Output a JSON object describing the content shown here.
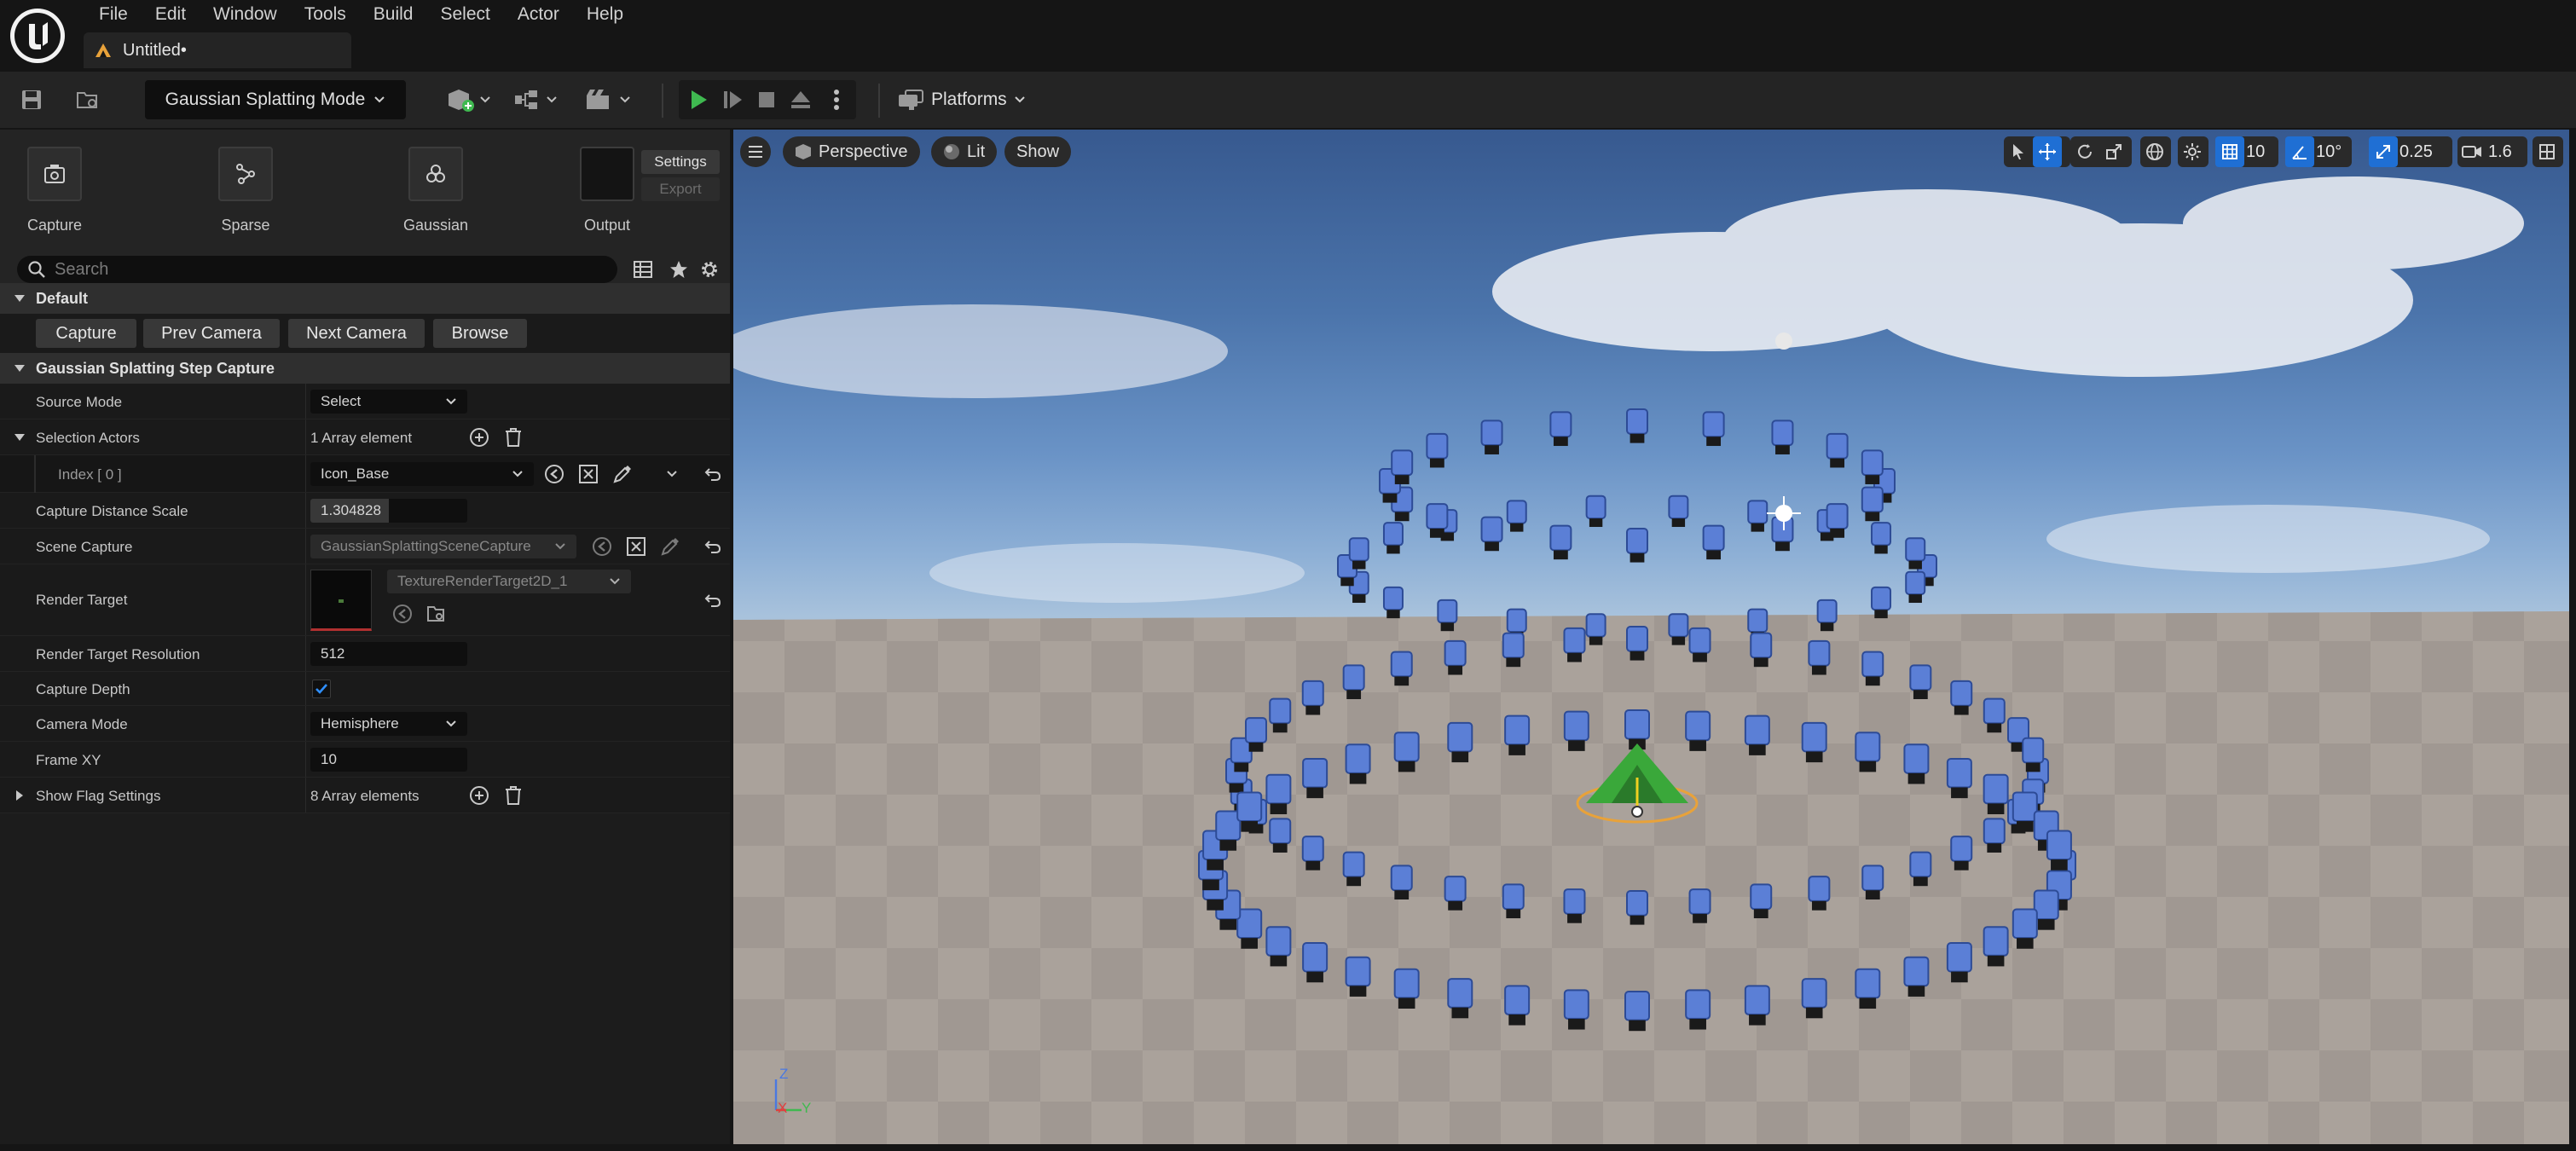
{
  "menu": [
    "File",
    "Edit",
    "Window",
    "Tools",
    "Build",
    "Select",
    "Actor",
    "Help"
  ],
  "document_tab": {
    "title": "Untitled•"
  },
  "toolbar": {
    "mode_select": "Gaussian Splatting Mode",
    "platforms_label": "Platforms"
  },
  "steps": [
    {
      "label": "Capture",
      "icon": "camera-icon"
    },
    {
      "label": "Sparse",
      "icon": "graph-icon"
    },
    {
      "label": "Gaussian",
      "icon": "circles-icon"
    },
    {
      "label": "Output",
      "icon": "output-preview"
    }
  ],
  "settings_label": "Settings",
  "export_label": "Export",
  "search": {
    "placeholder": "Search"
  },
  "default_category": {
    "title": "Default",
    "buttons": [
      "Capture",
      "Prev Camera",
      "Next Camera",
      "Browse"
    ]
  },
  "capture_category": {
    "title": "Gaussian Splatting Step Capture",
    "source_mode": {
      "label": "Source Mode",
      "value": "Select"
    },
    "selection_actors": {
      "label": "Selection Actors",
      "value": "1 Array element"
    },
    "index0": {
      "label": "Index [ 0 ]",
      "value": "Icon_Base"
    },
    "capture_distance_scale": {
      "label": "Capture Distance Scale",
      "value": "1.304828",
      "fill_fraction": 0.5
    },
    "scene_capture": {
      "label": "Scene Capture",
      "value": "GaussianSplattingSceneCapture"
    },
    "render_target": {
      "label": "Render Target",
      "value": "TextureRenderTarget2D_1"
    },
    "render_target_resolution": {
      "label": "Render Target Resolution",
      "value": "512"
    },
    "capture_depth": {
      "label": "Capture Depth",
      "checked": true
    },
    "camera_mode": {
      "label": "Camera Mode",
      "value": "Hemisphere"
    },
    "frame_xy": {
      "label": "Frame XY",
      "value": "10"
    },
    "show_flag_settings": {
      "label": "Show Flag Settings",
      "value": "8 Array elements"
    }
  },
  "viewport": {
    "perspective_label": "Perspective",
    "lit_label": "Lit",
    "show_label": "Show",
    "grid_snap": "10",
    "rotation_snap": "10°",
    "scale_snap": "0.25",
    "camera_speed": "1.6",
    "axis": {
      "x": "X",
      "y": "Y",
      "z": "Z"
    }
  },
  "colors": {
    "accent_blue": "#1f6fd4",
    "play_green": "#3fb950",
    "camera_blue": "#5b7fd6"
  }
}
